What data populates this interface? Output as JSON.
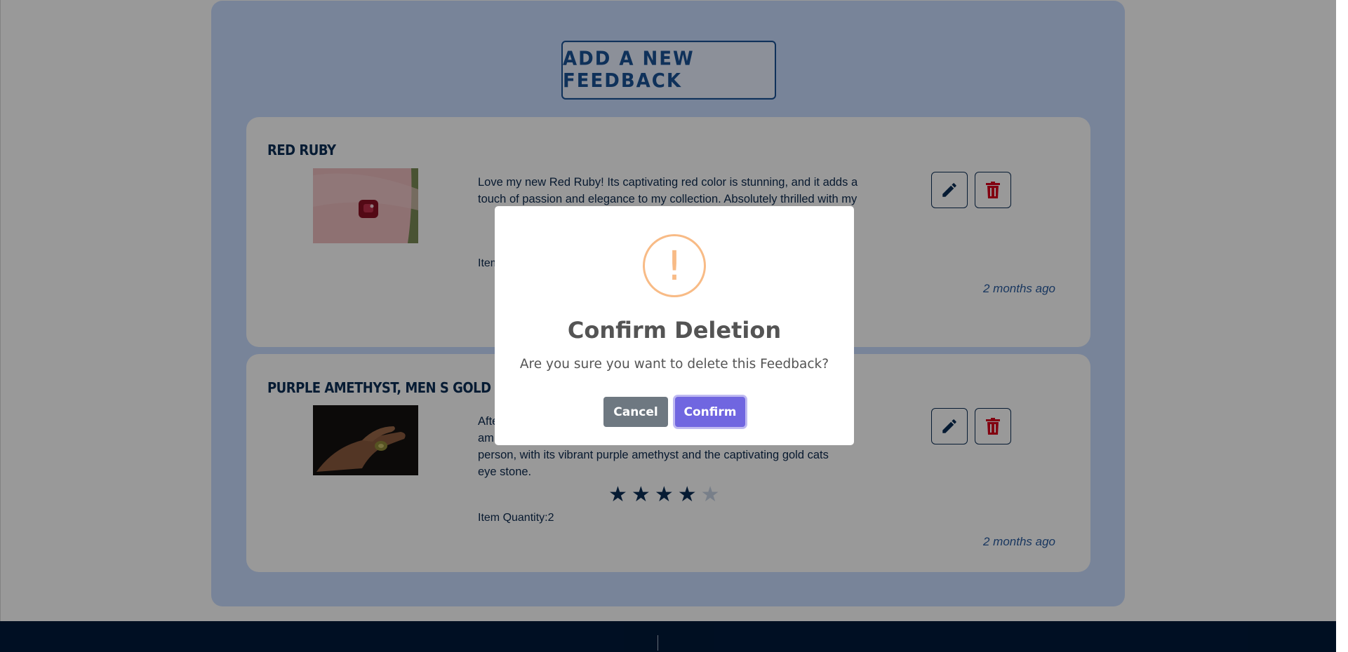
{
  "add_button": {
    "label": "ADD A NEW FEEDBACK"
  },
  "feedbacks": [
    {
      "title": "RED RUBY",
      "description": "Love my new Red Ruby! Its captivating red color is stunning, and it adds a touch of passion and elegance to my collection. Absolutely thrilled with my",
      "quantity_label": "Item",
      "time": "2 months ago"
    },
    {
      "title": "PURPLE AMETHYST, MEN S GOLD CATS EYE S",
      "description_lines": [
        "Afte",
        "am",
        "person, with its vibrant purple amethyst and the captivating gold cats",
        "eye stone."
      ],
      "rating": {
        "value": 4,
        "max": 5
      },
      "quantity_label": "Item Quantity:2",
      "time": "2 months ago"
    }
  ],
  "modal": {
    "icon": "!",
    "title": "Confirm Deletion",
    "text": "Are you sure you want to delete this Feedback?",
    "cancel_label": "Cancel",
    "confirm_label": "Confirm"
  },
  "colors": {
    "panel": "#c8dcff",
    "navy": "#0b2d55",
    "delete_red": "#d9001b",
    "confirm": "#7066e0",
    "cancel": "#6e7881",
    "warning": "#f8bb86",
    "footer": "#00193a"
  }
}
